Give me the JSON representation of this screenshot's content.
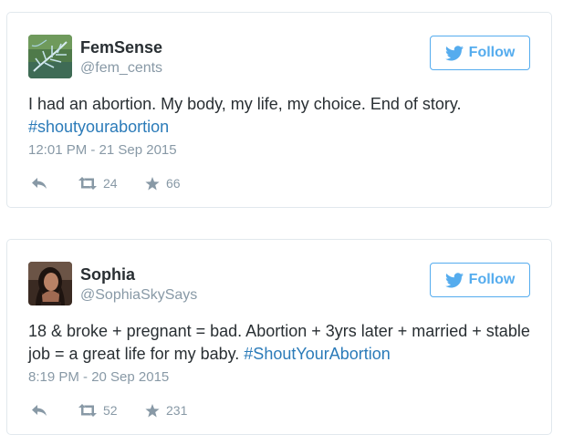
{
  "colors": {
    "accent": "#55acee",
    "link": "#2b7bb9",
    "muted": "#8899a6",
    "text": "#292f33",
    "border": "#e1e8ed"
  },
  "tweets": [
    {
      "display_name": "FemSense",
      "handle": "@fem_cents",
      "follow_label": "Follow",
      "text": "I had an abortion. My body, my life, my choice. End of story. ",
      "hashtag": "#shoutyourabortion",
      "timestamp": "12:01 PM - 21 Sep 2015",
      "retweets": "24",
      "favorites": "66",
      "avatar_icon": "fern-avatar-icon"
    },
    {
      "display_name": "Sophia",
      "handle": "@SophiaSkySays",
      "follow_label": "Follow",
      "text": "18 & broke + pregnant = bad. Abortion + 3yrs later + married + stable job = a great life for my baby. ",
      "hashtag": "#ShoutYourAbortion",
      "timestamp": "8:19 PM - 20 Sep 2015",
      "retweets": "52",
      "favorites": "231",
      "avatar_icon": "portrait-avatar-icon"
    }
  ]
}
